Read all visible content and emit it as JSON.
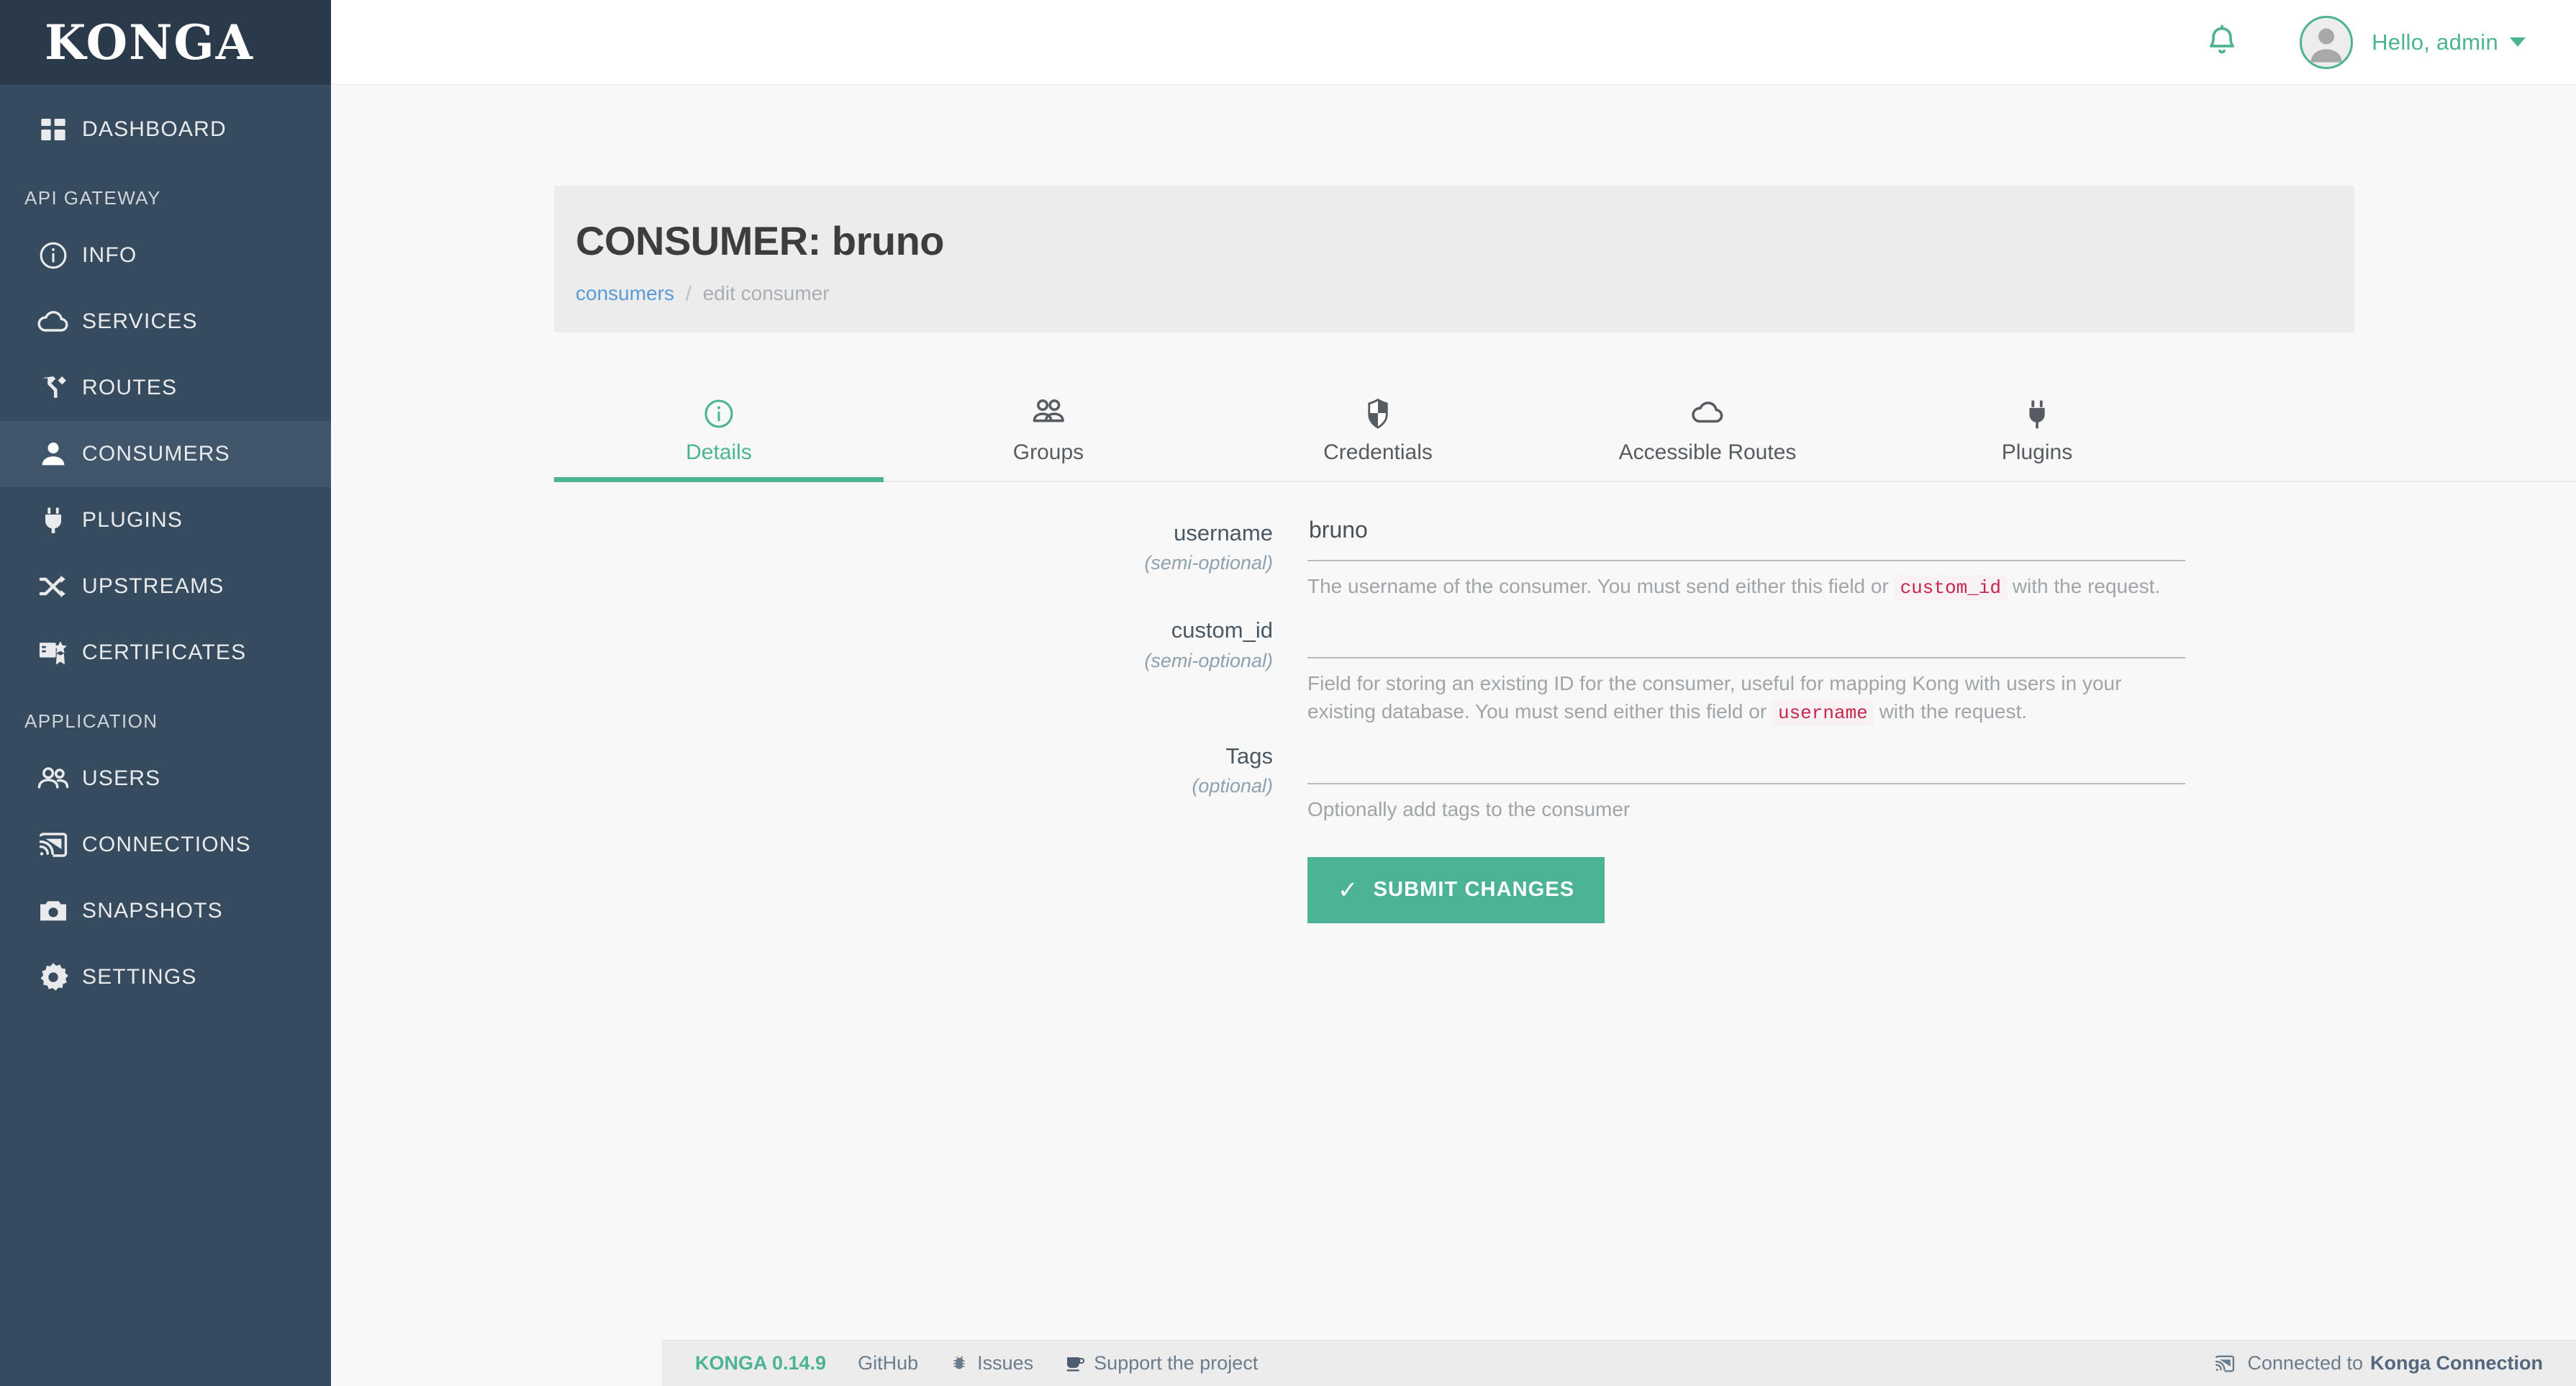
{
  "brand": {
    "logo": "KONGA",
    "accent": "#4cb395",
    "sidebar_bg": "#364b5e"
  },
  "topbar": {
    "bell_icon": "bell-icon",
    "avatar_icon": "avatar-icon",
    "greeting": "Hello, admin"
  },
  "sidebar": {
    "items": [
      {
        "label": "DASHBOARD",
        "icon": "dashboard-icon",
        "active": false
      },
      {
        "section": "API GATEWAY"
      },
      {
        "label": "INFO",
        "icon": "info-icon",
        "active": false
      },
      {
        "label": "SERVICES",
        "icon": "cloud-icon",
        "active": false
      },
      {
        "label": "ROUTES",
        "icon": "routes-icon",
        "active": false
      },
      {
        "label": "CONSUMERS",
        "icon": "consumer-icon",
        "active": true
      },
      {
        "label": "PLUGINS",
        "icon": "plug-icon",
        "active": false
      },
      {
        "label": "UPSTREAMS",
        "icon": "shuffle-icon",
        "active": false
      },
      {
        "label": "CERTIFICATES",
        "icon": "certificate-icon",
        "active": false
      },
      {
        "section": "APPLICATION"
      },
      {
        "label": "USERS",
        "icon": "users-icon",
        "active": false
      },
      {
        "label": "CONNECTIONS",
        "icon": "cast-icon",
        "active": false
      },
      {
        "label": "SNAPSHOTS",
        "icon": "camera-icon",
        "active": false
      },
      {
        "label": "SETTINGS",
        "icon": "gear-icon",
        "active": false
      }
    ]
  },
  "page": {
    "title": "CONSUMER: bruno",
    "breadcrumb": {
      "link": "consumers",
      "separator": "/",
      "current": "edit consumer"
    }
  },
  "tabs": [
    {
      "label": "Details",
      "icon": "info-circle-icon",
      "active": true
    },
    {
      "label": "Groups",
      "icon": "group-icon",
      "active": false
    },
    {
      "label": "Credentials",
      "icon": "shield-icon",
      "active": false
    },
    {
      "label": "Accessible Routes",
      "icon": "cloud-icon",
      "active": false
    },
    {
      "label": "Plugins",
      "icon": "plug-icon",
      "active": false
    }
  ],
  "form": {
    "fields": [
      {
        "name": "username",
        "optionality": "(semi-optional)",
        "value": "bruno",
        "placeholder": "",
        "help_before": "The username of the consumer. You must send either this field or ",
        "help_code": "custom_id",
        "help_after": " with the request."
      },
      {
        "name": "custom_id",
        "optionality": "(semi-optional)",
        "value": "",
        "placeholder": "",
        "help_before": "Field for storing an existing ID for the consumer, useful for mapping Kong with users in your existing database. You must send either this field or ",
        "help_code": "username",
        "help_after": " with the request."
      },
      {
        "name": "Tags",
        "optionality": "(optional)",
        "value": "",
        "placeholder": "",
        "help_before": "Optionally add tags to the consumer",
        "help_code": "",
        "help_after": ""
      }
    ],
    "submit_label": "SUBMIT CHANGES",
    "submit_check": "✓"
  },
  "footer": {
    "version": "KONGA 0.14.9",
    "github": "GitHub",
    "issues": "Issues",
    "support": "Support the project",
    "connection_prefix": "Connected to",
    "connection_name": "Konga Connection"
  }
}
